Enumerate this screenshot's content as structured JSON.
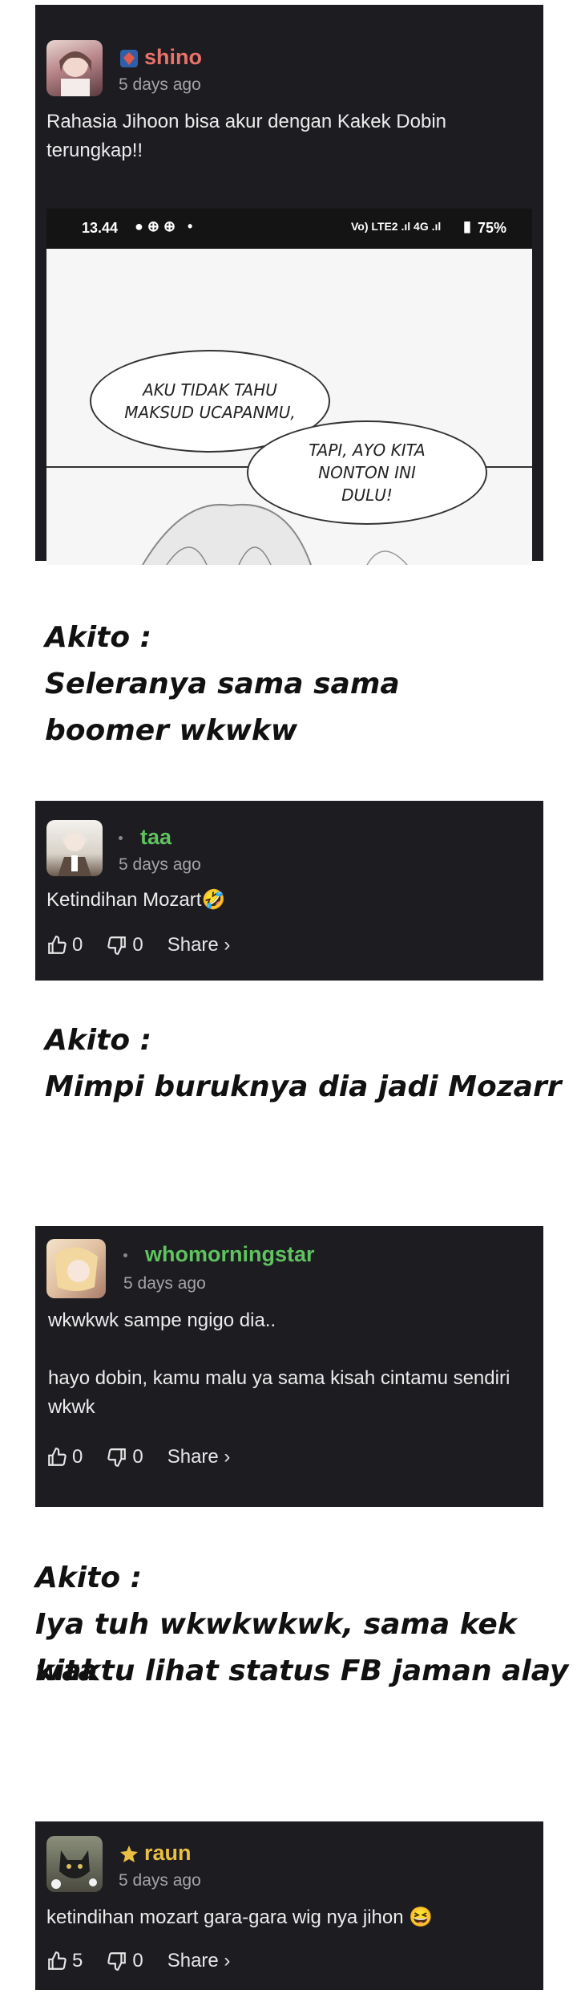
{
  "comments": [
    {
      "username": "shino",
      "time": "5 days ago",
      "text": "Rahasia Jihoon bisa akur dengan Kakek Dobin terungkap!!",
      "name_color": "#e9726b",
      "badge_icon": "blue-gem-icon",
      "screenshot": {
        "clock": "13.44",
        "network": "Vo) LTE2 .ıl 4G .ıl",
        "battery": "75%",
        "bubble1": "AKU TIDAK TAHU MAKSUD UCAPANMU,",
        "bubble2": "TAPI, AYO KITA NONTON INI DULU!"
      }
    },
    {
      "username": "taa",
      "time": "5 days ago",
      "text": "Ketindihan Mozart🤣",
      "name_color": "#5fc35f",
      "badge_icon": "dot-icon",
      "likes": "0",
      "dislikes": "0",
      "share": "Share ›"
    },
    {
      "username": "whomorningstar",
      "time": "5 days ago",
      "text": "wkwkwk sampe ngigo dia..\n\nhayo dobin, kamu malu ya sama kisah cintamu sendiri wkwk",
      "name_color": "#5fc35f",
      "badge_icon": "dot-icon",
      "likes": "0",
      "dislikes": "0",
      "share": "Share ›"
    },
    {
      "username": "raun",
      "time": "5 days ago",
      "text": "ketindihan mozart gara-gara wig nya jihon 😆",
      "name_color": "#e9c043",
      "badge_icon": "gold-badge-icon",
      "likes": "5",
      "dislikes": "0",
      "share": "Share ›"
    }
  ],
  "notes": [
    {
      "author": "Akito :",
      "lines": [
        "Seleranya sama sama",
        "boomer wkwkw"
      ]
    },
    {
      "author": "Akito :",
      "lines": [
        "Mimpi buruknya dia jadi Mozarr"
      ]
    },
    {
      "author": "Akito :",
      "lines": [
        "Iya tuh wkwkwkwk, sama kek kita",
        "waktu lihat status FB jaman alay"
      ]
    }
  ]
}
